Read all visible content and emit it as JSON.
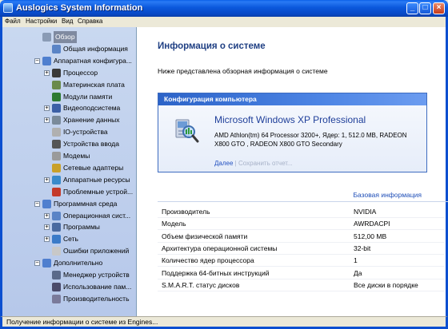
{
  "window": {
    "title": "Auslogics System Information",
    "buttons": {
      "minimize": "_",
      "maximize": "□",
      "close": "×"
    }
  },
  "menu": [
    "Файл",
    "Настройки",
    "Вид",
    "Справка"
  ],
  "sidebar": {
    "items": [
      {
        "label": "Обзор",
        "icon": "overview-icon",
        "color": "#8a9bb5",
        "expander": "",
        "selected": true
      },
      {
        "label": "Общая информация",
        "icon": "info-icon",
        "color": "#5a84c6",
        "expander": ""
      },
      {
        "label": "Аппаратная конфигура...",
        "icon": "hardware-icon",
        "color": "#4f7fcf",
        "expander": "−"
      },
      {
        "label": "Процессор",
        "icon": "cpu-icon",
        "color": "#3a3a3a",
        "expander": "+"
      },
      {
        "label": "Материнская плата",
        "icon": "motherboard-icon",
        "color": "#6a8a4a",
        "expander": ""
      },
      {
        "label": "Модули памяти",
        "icon": "memory-icon",
        "color": "#2e7a32",
        "expander": ""
      },
      {
        "label": "Видеоподсистема",
        "icon": "video-icon",
        "color": "#3b5fa6",
        "expander": "+"
      },
      {
        "label": "Хранение данных",
        "icon": "storage-icon",
        "color": "#7a8a9a",
        "expander": "+"
      },
      {
        "label": "IO-устройства",
        "icon": "io-icon",
        "color": "#b0b0b0",
        "expander": ""
      },
      {
        "label": "Устройства ввода",
        "icon": "keyboard-icon",
        "color": "#555555",
        "expander": ""
      },
      {
        "label": "Модемы",
        "icon": "modem-icon",
        "color": "#9a9a9a",
        "expander": ""
      },
      {
        "label": "Сетевые адаптеры",
        "icon": "network-adapter-icon",
        "color": "#c9a02a",
        "expander": ""
      },
      {
        "label": "Аппаратные ресурсы",
        "icon": "resources-icon",
        "color": "#3a8acb",
        "expander": "+"
      },
      {
        "label": "Проблемные устрой...",
        "icon": "problem-device-icon",
        "color": "#c43a2a",
        "expander": ""
      },
      {
        "label": "Программная среда",
        "icon": "software-icon",
        "color": "#4f7fcf",
        "expander": "−"
      },
      {
        "label": "Операционная сист...",
        "icon": "os-icon",
        "color": "#5a84c6",
        "expander": "+"
      },
      {
        "label": "Программы",
        "icon": "programs-icon",
        "color": "#4a6aa0",
        "expander": "+"
      },
      {
        "label": "Сеть",
        "icon": "network-icon",
        "color": "#3a7ac8",
        "expander": "+"
      },
      {
        "label": "Ошибки приложений",
        "icon": "app-errors-icon",
        "color": "#c8c8c8",
        "expander": ""
      },
      {
        "label": "Дополнительно",
        "icon": "additional-icon",
        "color": "#4f7fcf",
        "expander": "−"
      },
      {
        "label": "Менеджер устройств",
        "icon": "device-manager-icon",
        "color": "#5a6a8a",
        "expander": ""
      },
      {
        "label": "Использование пам...",
        "icon": "memory-usage-icon",
        "color": "#4a4a6a",
        "expander": ""
      },
      {
        "label": "Производительность",
        "icon": "performance-icon",
        "color": "#7a7a9a",
        "expander": ""
      }
    ]
  },
  "main": {
    "title": "Информация о системе",
    "description": "Ниже представлена обзорная информация о системе",
    "config": {
      "header": "Конфигурация компьютера",
      "os_name": "Microsoft Windows XP Professional",
      "os_detail": "AMD Athlon(tm) 64 Processor 3200+, Ядер: 1, 512.0 MB, RADEON X800 GTO , RADEON X800 GTO Secondary",
      "link_more": "Далее",
      "separator": "|",
      "link_save": "Сохранить отчет..."
    },
    "basic_info_link": "Базовая информация",
    "rows": [
      {
        "key": "Производитель",
        "value": "NVIDIA"
      },
      {
        "key": "Модель",
        "value": "AWRDACPI"
      },
      {
        "key": "Объем физической памяти",
        "value": "512,00 MB"
      },
      {
        "key": "Архитектура операционной системы",
        "value": "32-bit"
      },
      {
        "key": "Количество ядер процессора",
        "value": "1"
      },
      {
        "key": "Поддержка 64-битных инструкций",
        "value": "Да"
      },
      {
        "key": "S.M.A.R.T. статус дисков",
        "value": "Все диски в порядке"
      }
    ]
  },
  "status": "Получение информации о системе из Engines..."
}
